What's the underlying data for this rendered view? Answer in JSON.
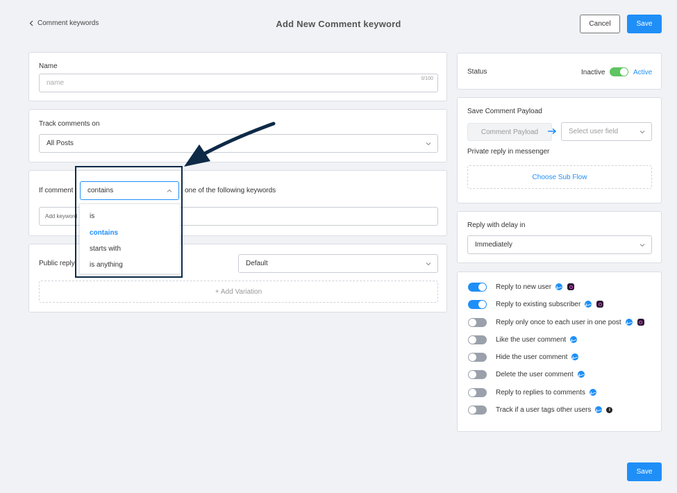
{
  "header": {
    "back_label": "Comment keywords",
    "title": "Add New Comment keyword",
    "cancel_label": "Cancel",
    "save_label": "Save"
  },
  "name_card": {
    "label": "Name",
    "placeholder": "name",
    "counter": "0/100"
  },
  "track_card": {
    "label": "Track comments on",
    "value": "All Posts"
  },
  "condition_card": {
    "prefix": "If comment",
    "operator": "contains",
    "suffix": "one of the following keywords",
    "keyword_placeholder": "Add keyword",
    "dropdown_options": [
      "is",
      "contains",
      "starts with",
      "is anything"
    ],
    "selected_option": "contains"
  },
  "reply_card": {
    "label": "Public reply",
    "value": "Default",
    "add_variation": "+ Add Variation"
  },
  "status_card": {
    "label": "Status",
    "inactive": "Inactive",
    "active": "Active",
    "is_active": true
  },
  "payload_card": {
    "label": "Save Comment Payload",
    "payload_field": "Comment Payload",
    "user_field_placeholder": "Select user field",
    "private_reply_label": "Private reply in messenger",
    "sub_flow_label": "Choose Sub Flow"
  },
  "delay_card": {
    "label": "Reply with delay in",
    "value": "Immediately"
  },
  "options": [
    {
      "label": "Reply to new user",
      "on": true,
      "icons": [
        "messenger-icon",
        "instagram-icon"
      ]
    },
    {
      "label": "Reply to existing subscriber",
      "on": true,
      "icons": [
        "messenger-icon",
        "instagram-icon"
      ]
    },
    {
      "label": "Reply only once to each user in one post",
      "on": false,
      "icons": [
        "messenger-icon",
        "instagram-icon"
      ]
    },
    {
      "label": "Like the user comment",
      "on": false,
      "icons": [
        "messenger-icon"
      ]
    },
    {
      "label": "Hide the user comment",
      "on": false,
      "icons": [
        "messenger-icon"
      ]
    },
    {
      "label": "Delete the user comment",
      "on": false,
      "icons": [
        "messenger-icon"
      ]
    },
    {
      "label": "Reply to replies to comments",
      "on": false,
      "icons": [
        "messenger-icon"
      ]
    },
    {
      "label": "Track if a user tags other users",
      "on": false,
      "icons": [
        "messenger-icon",
        "info-icon"
      ]
    }
  ],
  "colors": {
    "accent": "#1f8ff7",
    "active_toggle": "#5ec560",
    "highlight_box": "#0e2a47"
  }
}
